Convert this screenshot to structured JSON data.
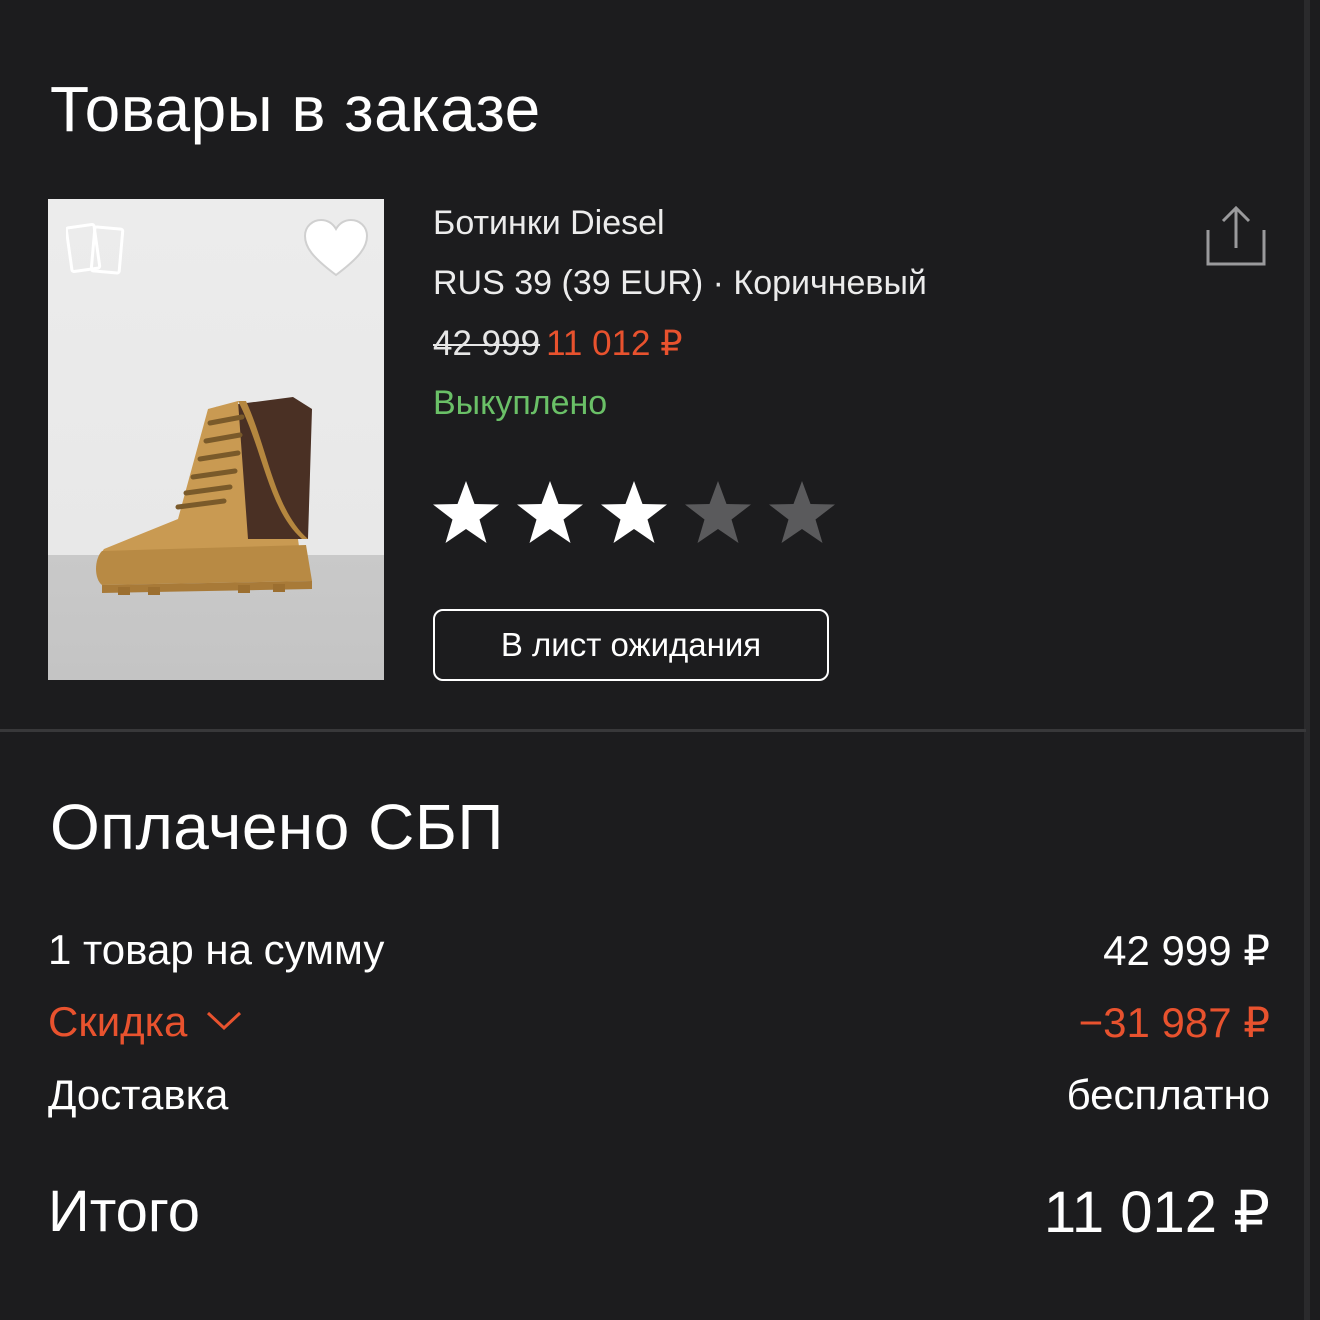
{
  "order": {
    "title": "Товары в заказе"
  },
  "product": {
    "name": "Ботинки Diesel",
    "variant": "RUS 39 (39 EUR) · Коричневый",
    "old_price": "42 999",
    "new_price": "11 012 ₽",
    "status": "Выкуплено",
    "rating": {
      "value": 3,
      "max": 5
    },
    "waitlist_label": "В лист ожидания"
  },
  "payment": {
    "title": "Оплачено СБП",
    "items_label": "1 товар на сумму",
    "items_value": "42 999 ₽",
    "discount_label": "Скидка",
    "discount_value": "−31 987 ₽",
    "delivery_label": "Доставка",
    "delivery_value": "бесплатно",
    "total_label": "Итого",
    "total_value": "11 012 ₽"
  },
  "colors": {
    "background": "#1c1c1e",
    "accent": "#e8522e",
    "success": "#6ac067",
    "star_filled": "#ffffff",
    "star_empty": "#5a5a5c"
  },
  "icons": [
    "compare-icon",
    "heart-icon",
    "share-icon",
    "star-icon",
    "chevron-down-icon"
  ]
}
